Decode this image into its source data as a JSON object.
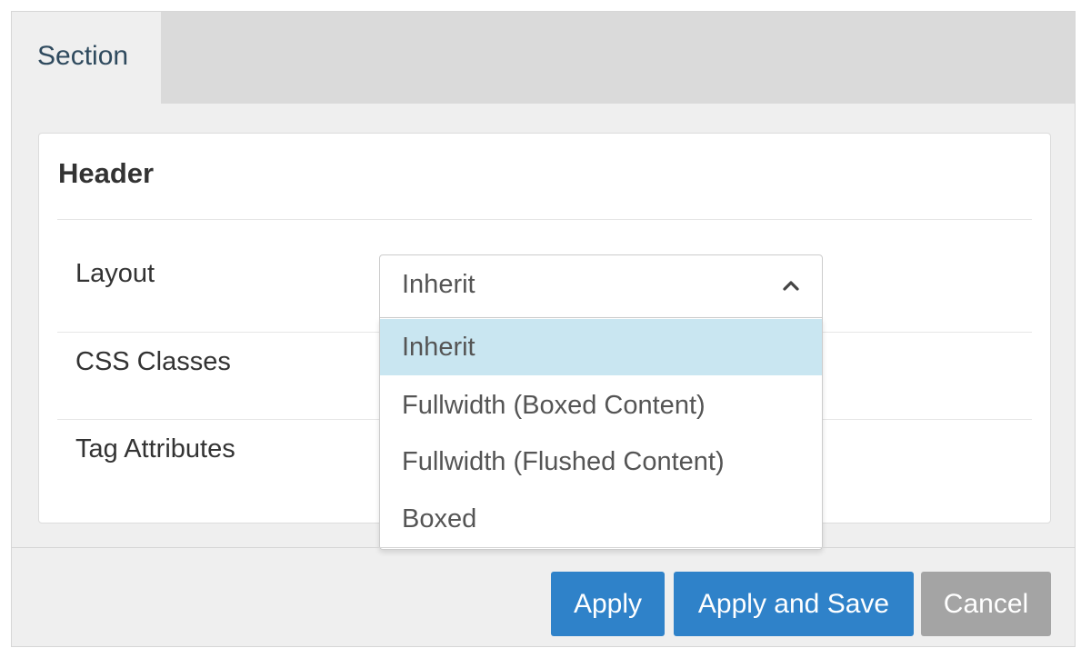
{
  "tabs": [
    {
      "label": "Section",
      "active": true
    }
  ],
  "panel": {
    "title": "Header",
    "rows": [
      {
        "label": "Layout"
      },
      {
        "label": "CSS Classes"
      },
      {
        "label": "Tag Attributes"
      }
    ]
  },
  "layout_select": {
    "value": "Inherit",
    "expanded": true,
    "options": [
      {
        "label": "Inherit",
        "selected": true
      },
      {
        "label": "Fullwidth (Boxed Content)",
        "selected": false
      },
      {
        "label": "Fullwidth (Flushed Content)",
        "selected": false
      },
      {
        "label": "Boxed",
        "selected": false
      }
    ]
  },
  "buttons": {
    "apply": "Apply",
    "apply_and_save": "Apply and Save",
    "cancel": "Cancel"
  },
  "icons": {
    "chevron": "chevron-up-icon"
  },
  "colors": {
    "primary_button": "#2f82c9",
    "cancel_button": "#a4a4a4",
    "selected_option": "#c9e6f1",
    "tab_text": "#2f4a5e"
  }
}
